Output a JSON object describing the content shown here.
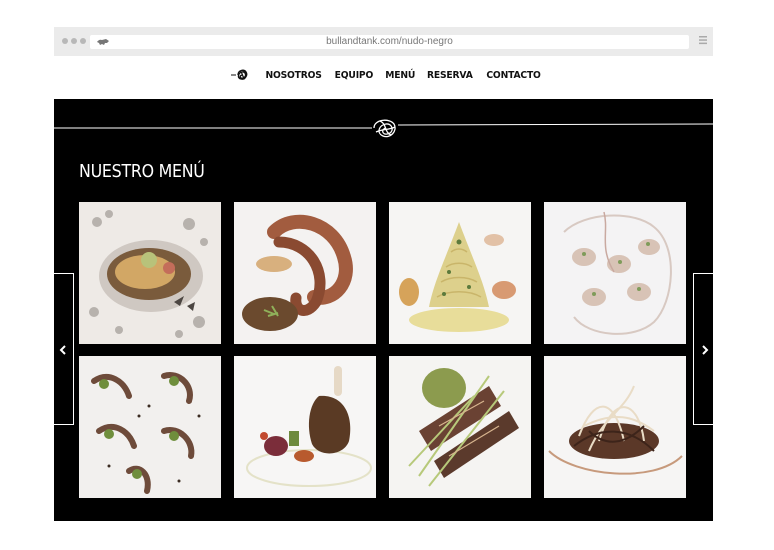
{
  "browser": {
    "url": "bullandtank.com/nudo-negro"
  },
  "nav": {
    "items": [
      {
        "label": "NOSOTROS",
        "name": "nav-item-nosotros"
      },
      {
        "label": "EQUIPO",
        "name": "nav-item-equipo"
      },
      {
        "label": "MENÚ",
        "name": "nav-item-menu"
      },
      {
        "label": "RESERVA",
        "name": "nav-item-reserva"
      },
      {
        "label": "CONTACTO",
        "name": "nav-item-contacto"
      }
    ]
  },
  "main": {
    "title": "NUESTRO MENÚ"
  },
  "gallery": {
    "dishes": [
      "oyster",
      "octopus",
      "pasta",
      "shrimp-plate",
      "herb-spirals",
      "lamb-shank",
      "fish-strips",
      "tangled-dish"
    ]
  },
  "icons": {
    "logo": "knot-logo-icon",
    "prev": "chevron-left-icon",
    "next": "chevron-right-icon",
    "menu": "hamburger-icon"
  },
  "colors": {
    "hero_background": "#000000",
    "nav_text": "#111111",
    "browser_chrome": "#ebebeb"
  }
}
